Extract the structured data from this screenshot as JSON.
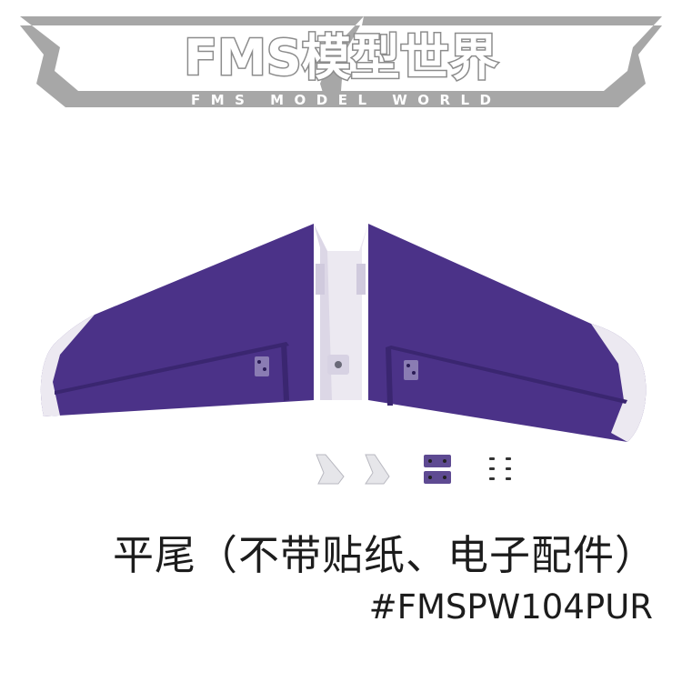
{
  "logo": {
    "brand": "FMS模型世界",
    "tagline": "FMS MODEL WORLD"
  },
  "product": {
    "caption": "平尾（不带贴纸、电子配件）",
    "part_number": "#FMSPW104PUR"
  },
  "colors": {
    "wing_purple": "#4b3288",
    "wing_purple_dark": "#3a2670",
    "foam_white": "#ece9f1",
    "logo_gray": "#9a9a9a",
    "text": "#1c1c1c"
  }
}
